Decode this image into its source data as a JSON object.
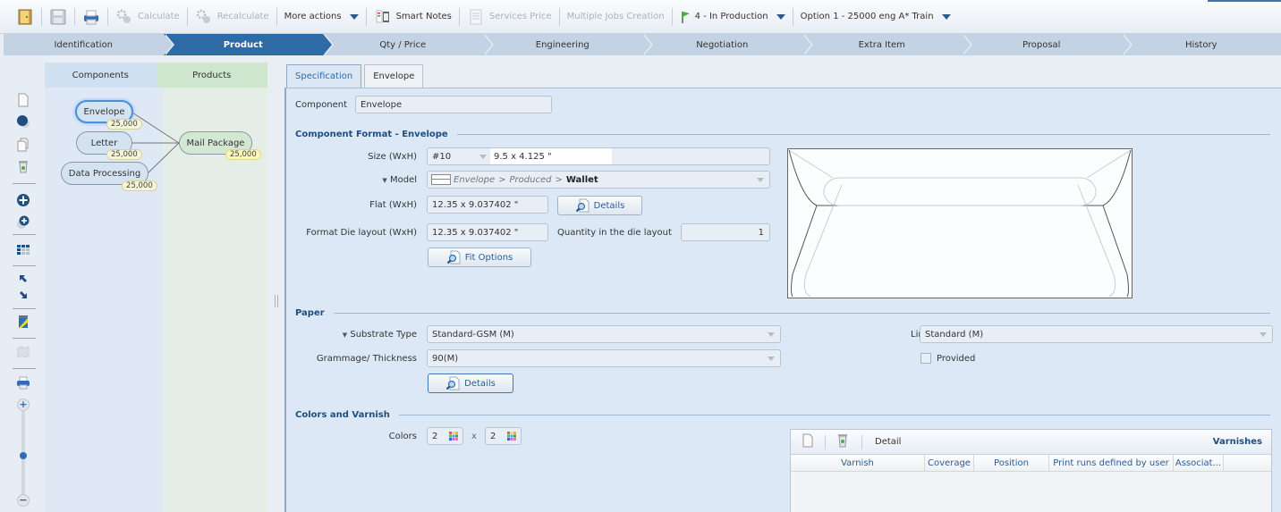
{
  "toolbar": {
    "calculate": "Calculate",
    "recalculate": "Recalculate",
    "more_actions": "More actions",
    "smart_notes": "Smart Notes",
    "services_price": "Services Price",
    "multiple_jobs": "Multiple Jobs Creation",
    "status": "4 - In Production",
    "option": "Option 1 - 25000 eng A* Train"
  },
  "steps": [
    "Identification",
    "Product",
    "Qty / Price",
    "Engineering",
    "Negotiation",
    "Extra Item",
    "Proposal",
    "History"
  ],
  "active_step": "Product",
  "panel": {
    "components_header": "Components",
    "products_header": "Products",
    "components": [
      {
        "name": "Envelope",
        "qty": "25,000",
        "selected": true
      },
      {
        "name": "Letter",
        "qty": "25,000",
        "selected": false
      },
      {
        "name": "Data Processing",
        "qty": "25,000",
        "selected": false
      }
    ],
    "product": {
      "name": "Mail Package",
      "qty": "25,000"
    }
  },
  "tabs": [
    "Specification",
    "Envelope"
  ],
  "active_tab": "Specification",
  "form": {
    "component_label": "Component",
    "component_value": "Envelope",
    "format_section": "Component Format - Envelope",
    "size_label": "Size (WxH)",
    "size_preset": "#10",
    "size_value": "9.5 x 4.125 \"",
    "model_label": "Model",
    "model_path_1": "Envelope",
    "model_sep": ">",
    "model_path_2": "Produced",
    "model_path_3": "Wallet",
    "flat_label": "Flat (WxH)",
    "flat_value": "12.35 x 9.037402 \"",
    "details_button": "Details",
    "die_label": "Format Die layout (WxH)",
    "die_value": "12.35 x 9.037402 \"",
    "die_qty_label": "Quantity in the die layout",
    "die_qty_value": "1",
    "fit_options_button": "Fit Options",
    "paper_section": "Paper",
    "substrate_label": "Substrate Type",
    "substrate_value": "Standard-GSM (M)",
    "line_label": "Line",
    "line_value": "Standard (M)",
    "grammage_label": "Grammage/ Thickness",
    "grammage_value": "90(M)",
    "provided_label": "Provided",
    "provided_checked": false,
    "paper_details_button": "Details",
    "colors_section": "Colors and Varnish",
    "colors_label": "Colors",
    "colors_front": "2",
    "colors_x": "x",
    "colors_back": "2"
  },
  "varnishes": {
    "title": "Varnishes",
    "detail_label": "Detail",
    "columns": [
      "Varnish",
      "Coverage",
      "Position",
      "Print runs defined by user",
      "Associat..."
    ],
    "rows": []
  }
}
